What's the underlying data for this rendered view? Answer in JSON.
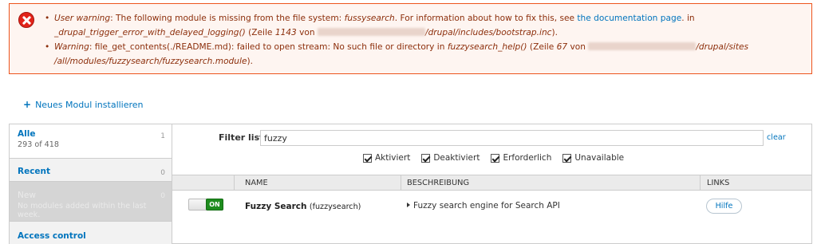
{
  "messages": {
    "item1": {
      "type": "User warning",
      "text_a": ": The following module is missing from the file system: ",
      "module": "fussysearch",
      "text_b": ". For information about how to fix this, see ",
      "link": "the documentation page",
      "text_c": ". in",
      "func": "_drupal_trigger_error_with_delayed_logging()",
      "zeile": " (Zeile ",
      "line": "1143",
      "von": " von ",
      "path": "/drupal/includes/bootstrap.inc",
      "close": ")."
    },
    "item2": {
      "type": "Warning",
      "text_a": ": file_get_contents(./README.md): failed to open stream: No such file or directory in ",
      "func": "fuzzysearch_help()",
      "zeile": " (Zeile ",
      "line": "67",
      "von": " von ",
      "path1": "/drupal/sites",
      "path2": "/all/modules/fuzzysearch/fuzzysearch.module",
      "close": ")."
    }
  },
  "action_link": "Neues Modul installieren",
  "sidebar": {
    "all": {
      "label": "Alle",
      "sub": "293 of 418",
      "count": "1"
    },
    "recent": {
      "label": "Recent",
      "count": "0"
    },
    "new": {
      "label": "New",
      "sub": "No modules added within the last week.",
      "count": "0"
    },
    "access": {
      "label": "Access control"
    }
  },
  "filter": {
    "label": "Filter list",
    "value": "fuzzy",
    "clear": "clear",
    "checkboxes": [
      "Aktiviert",
      "Deaktiviert",
      "Erforderlich",
      "Unavailable"
    ]
  },
  "table": {
    "headers": {
      "name": "NAME",
      "description": "BESCHREIBUNG",
      "links": "LINKS"
    },
    "row": {
      "toggle": "ON",
      "name": "Fuzzy Search",
      "machine": "(fuzzysearch)",
      "description": "Fuzzy search engine for Search API",
      "help": "Hilfe"
    }
  },
  "colors": {
    "error_border": "#ed541d",
    "error_bg": "#fef5f1",
    "link": "#0074bd",
    "toggle_on": "#1e8c1e"
  }
}
